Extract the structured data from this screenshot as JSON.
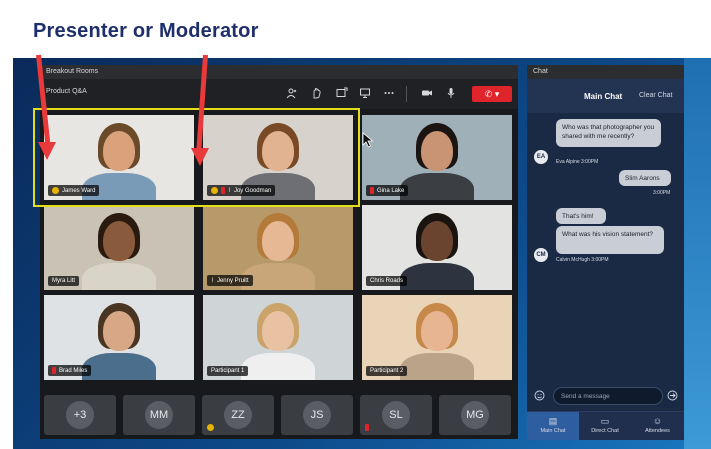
{
  "caption": "Presenter or Moderator",
  "meeting": {
    "window_title": "Breakout Rooms",
    "room_title": "Product Q&A",
    "toolbar": [
      "people-icon",
      "raise-hand-icon",
      "share-screen-icon",
      "presentation-icon",
      "more-icon",
      "camera-icon",
      "microphone-icon"
    ],
    "end_label": "✆ ▾"
  },
  "tiles": [
    {
      "name": "James Ward",
      "badges": [
        "yellow"
      ],
      "bg": "#e8e6e2",
      "skin": "#d9a27a",
      "hair": "#6b4a2a",
      "shirt": "#7a9bb8"
    },
    {
      "name": "Joy Goodman",
      "badges": [
        "yellow",
        "red",
        "mic"
      ],
      "bg": "#d7d2cb",
      "skin": "#e2b391",
      "hair": "#7a4a26",
      "shirt": "#6d6f75"
    },
    {
      "name": "Gina Lake",
      "badges": [
        "red"
      ],
      "bg": "#9fb0b9",
      "skin": "#c99473",
      "hair": "#1c1410",
      "shirt": "#3b3f44"
    },
    {
      "name": "Myra Litt",
      "badges": [],
      "bg": "#c9c2b5",
      "skin": "#8a5a3c",
      "hair": "#2a1a10",
      "shirt": "#d9d4c8"
    },
    {
      "name": "Jenny Pruitt",
      "badges": [
        "mic"
      ],
      "bg": "#b89a6a",
      "skin": "#e6b894",
      "hair": "#b47a3a",
      "shirt": "#c8a67a"
    },
    {
      "name": "Chris Roads",
      "badges": [],
      "bg": "#e3e3e1",
      "skin": "#6b4430",
      "hair": "#1a1410",
      "shirt": "#2d3440"
    },
    {
      "name": "Brad Miles",
      "badges": [
        "red"
      ],
      "bg": "#dfe2e4",
      "skin": "#d8a886",
      "hair": "#4a3522",
      "shirt": "#4a6e8c"
    },
    {
      "name": "Participant 1",
      "badges": [],
      "bg": "#cfd4d6",
      "skin": "#e8c2a2",
      "hair": "#caa36a",
      "shirt": "#efefef"
    },
    {
      "name": "Participant 2",
      "badges": [],
      "bg": "#e9d4b8",
      "skin": "#e7b592",
      "hair": "#c7894a",
      "shirt": "#b9a48a"
    }
  ],
  "thumbnails": [
    {
      "label": "+3",
      "badge": ""
    },
    {
      "label": "MM",
      "badge": ""
    },
    {
      "label": "ZZ",
      "badge": "yellow"
    },
    {
      "label": "JS",
      "badge": ""
    },
    {
      "label": "SL",
      "badge": "red"
    },
    {
      "label": "MG",
      "badge": ""
    }
  ],
  "chat": {
    "window_title": "Chat",
    "header": "Main Chat",
    "clear": "Clear Chat",
    "messages": [
      {
        "text": "Who was that photographer you shared with me recently?",
        "meta": "Eva Alpine  3:00PM",
        "avatar": "EA"
      },
      {
        "text": "Slim Aarons",
        "meta": "3:00PM",
        "avatar": ""
      },
      {
        "text": "That's him!",
        "meta": "",
        "avatar": ""
      },
      {
        "text": "What was his vision statement?",
        "meta": "Calvin McHugh  3:00PM",
        "avatar": "CM"
      }
    ],
    "input_placeholder": "Send a message",
    "tabs": [
      "Main Chat",
      "Direct Chat",
      "Attendees"
    ]
  }
}
